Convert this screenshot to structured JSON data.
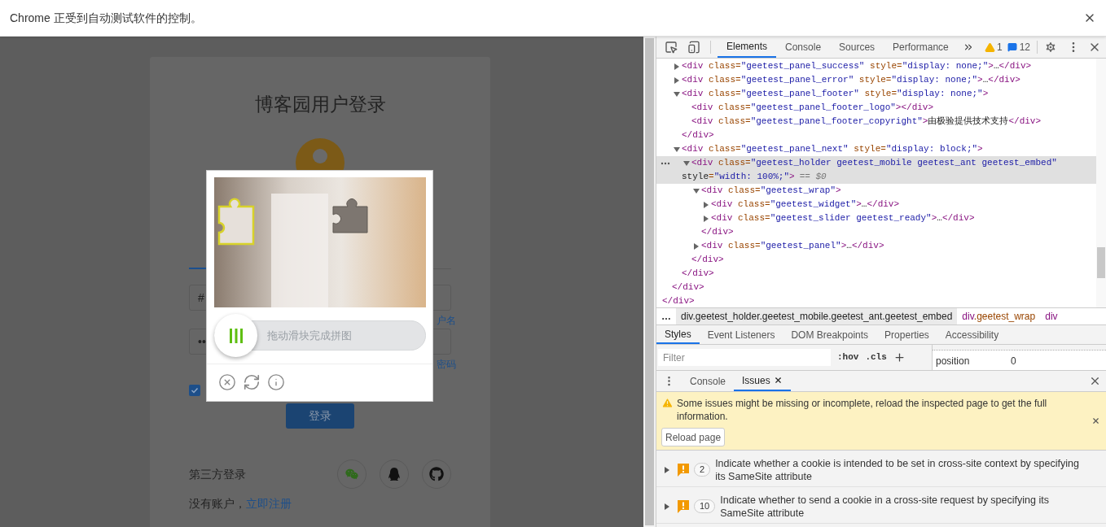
{
  "infobar": {
    "text": "Chrome 正受到自动测试软件的控制。"
  },
  "login": {
    "title": "博客园用户登录",
    "username_value": "#",
    "password_value": "••",
    "forgot_username": "户名",
    "forgot_password": "密码",
    "remember_checked": true,
    "login_button": "登录",
    "third_party_label": "第三方登录",
    "no_account": "没有账户，",
    "register_link": "立即注册"
  },
  "captcha": {
    "slider_hint": "拖动滑块完成拼图",
    "level": 0
  },
  "devtools": {
    "tabs": [
      {
        "label": "Elements",
        "selected": true
      },
      {
        "label": "Console",
        "selected": false
      },
      {
        "label": "Sources",
        "selected": false
      },
      {
        "label": "Performance",
        "selected": false
      }
    ],
    "warnings": "1",
    "messages": "12",
    "tree": {
      "close": "</div>",
      "children": [
        {
          "close": "</div>",
          "children": [
            {
              "open": "<div class=\"geetest_panel_success\" style=\"display: none;\">…</div>",
              "expanded": false,
              "selected": false
            },
            {
              "open": "<div class=\"geetest_panel_error\" style=\"display: none;\">…</div>",
              "expanded": false,
              "selected": false
            },
            {
              "open": "<div class=\"geetest_panel_footer\" style=\"display: none;\">",
              "expanded": true,
              "selected": false,
              "close": "</div>",
              "children": [
                {
                  "open": "<div class=\"geetest_panel_footer_logo\"></div>",
                  "selected": false
                },
                {
                  "open": "<div class=\"geetest_panel_footer_copyright\">由极验提供技术支持</div>",
                  "selected": false
                }
              ]
            },
            {
              "open": "<div class=\"geetest_panel_next\" style=\"display: block;\">",
              "expanded": true,
              "selected": false,
              "close": "</div>",
              "children": [
                {
                  "open": "<div class=\"geetest_holder geetest_mobile geetest_ant geetest_embed\"",
                  "open_continued": "style=\"width: 100%;\">",
                  "marker": "== $0",
                  "expanded": true,
                  "selected": true,
                  "close": "</div>",
                  "children": [
                    {
                      "open": "<div class=\"geetest_wrap\">",
                      "expanded": true,
                      "selected": false,
                      "close": "</div>",
                      "children": [
                        {
                          "open": "<div class=\"geetest_widget\">…</div>",
                          "expanded": false,
                          "selected": false
                        },
                        {
                          "open": "<div class=\"geetest_slider geetest_ready\">…</div>",
                          "expanded": false,
                          "selected": false
                        }
                      ]
                    },
                    {
                      "open": "<div class=\"geetest_panel\">…</div>",
                      "expanded": false,
                      "selected": false
                    }
                  ]
                }
              ]
            }
          ]
        }
      ]
    },
    "breadcrumb_overflow": "…",
    "breadcrumbs": [
      {
        "text": "div.geetest_holder.geetest_mobile.geetest_ant.geetest_embed",
        "selected": true
      },
      {
        "text": "div.geetest_wrap",
        "selected": false
      },
      {
        "text": "div",
        "selected": false
      }
    ],
    "styles_tabs": [
      {
        "label": "Styles",
        "selected": true
      },
      {
        "label": "Event Listeners",
        "selected": false
      },
      {
        "label": "DOM Breakpoints",
        "selected": false
      },
      {
        "label": "Properties",
        "selected": false
      },
      {
        "label": "Accessibility",
        "selected": false
      }
    ],
    "filter": {
      "placeholder": "Filter"
    },
    "hov": ":hov",
    "cls": ".cls",
    "computed": {
      "property": "position",
      "value": "0"
    },
    "drawer_tabs": [
      {
        "label": "Console",
        "selected": false,
        "closable": false
      },
      {
        "label": "Issues",
        "selected": true,
        "closable": true
      }
    ],
    "banner": {
      "text": "Some issues might be missing or incomplete, reload the inspected page to get the full information.",
      "button": "Reload page"
    },
    "issues": [
      {
        "count": "2",
        "text": "Indicate whether a cookie is intended to be set in cross-site context by specifying its SameSite attribute"
      },
      {
        "count": "10",
        "text": "Indicate whether to send a cookie in a cross-site request by specifying its SameSite attribute"
      }
    ]
  }
}
